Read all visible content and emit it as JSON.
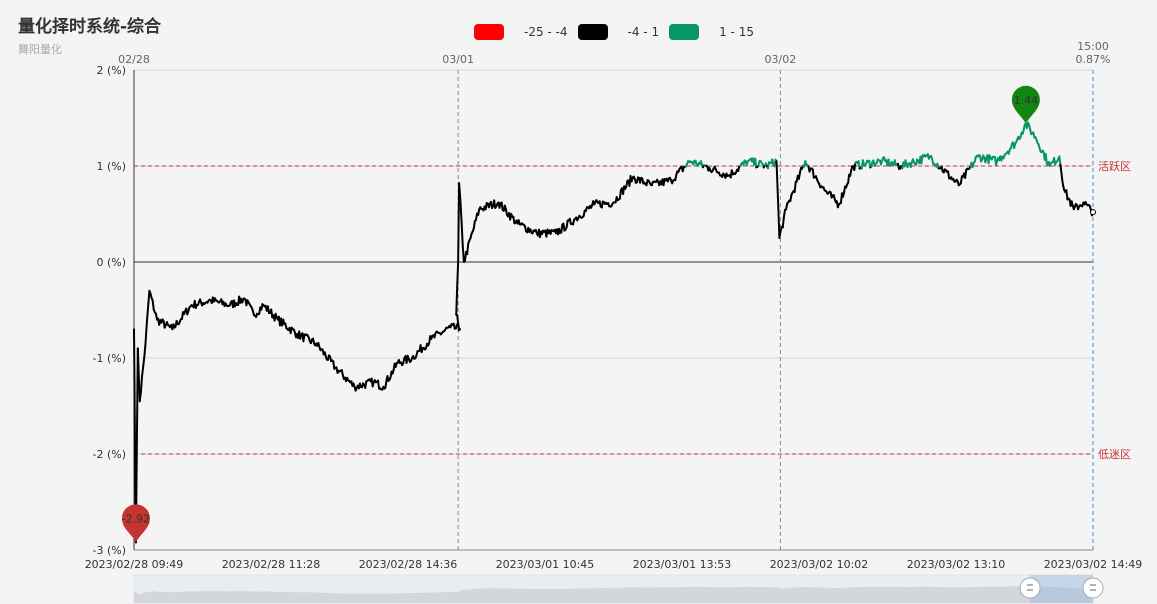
{
  "title": "量化择时系统-综合",
  "subtitle": "舞阳量化",
  "legend": [
    {
      "label": "-25 - -4",
      "color": "#ff0000"
    },
    {
      "label": "-4 - 1",
      "color": "#000000"
    },
    {
      "label": "1 - 15",
      "color": "#079664"
    }
  ],
  "chart_data": {
    "type": "line",
    "ylim": [
      -3,
      2
    ],
    "y_ticks": [
      "2 (%)",
      "1 (%)",
      "0 (%)",
      "-1 (%)",
      "-2 (%)",
      "-3 (%)"
    ],
    "x_ticks": [
      "2023/02/28 09:49",
      "2023/02/28 11:28",
      "2023/02/28 14:36",
      "2023/03/01 10:45",
      "2023/03/01 13:53",
      "2023/03/02 10:02",
      "2023/03/02 13:10",
      "2023/03/02 14:49"
    ],
    "top_axis_labels": [
      "02/28",
      "03/01",
      "03/02"
    ],
    "current_time_label": "15:00",
    "current_value_label": "0.87%",
    "mark_lines": [
      {
        "value": 1,
        "label": "活跃区"
      },
      {
        "value": -2,
        "label": "低迷区"
      }
    ],
    "max_point": {
      "value": 1.44,
      "label": "1.44"
    },
    "min_point": {
      "value": -2.92,
      "label": "-2.92"
    },
    "visual_map": [
      {
        "range": [
          -25,
          -4
        ],
        "color": "#ff0000"
      },
      {
        "range": [
          -4,
          1
        ],
        "color": "#000000"
      },
      {
        "range": [
          1,
          15
        ],
        "color": "#079664"
      }
    ],
    "series_keypoints": [
      [
        0,
        -0.7
      ],
      [
        0.002,
        -2.92
      ],
      [
        0.004,
        -0.9
      ],
      [
        0.006,
        -1.45
      ],
      [
        0.012,
        -0.85
      ],
      [
        0.016,
        -0.3
      ],
      [
        0.024,
        -0.6
      ],
      [
        0.04,
        -0.7
      ],
      [
        0.06,
        -0.45
      ],
      [
        0.08,
        -0.4
      ],
      [
        0.1,
        -0.45
      ],
      [
        0.115,
        -0.38
      ],
      [
        0.125,
        -0.55
      ],
      [
        0.135,
        -0.45
      ],
      [
        0.15,
        -0.6
      ],
      [
        0.17,
        -0.75
      ],
      [
        0.19,
        -0.85
      ],
      [
        0.21,
        -1.1
      ],
      [
        0.23,
        -1.3
      ],
      [
        0.25,
        -1.25
      ],
      [
        0.26,
        -1.3
      ],
      [
        0.275,
        -1.05
      ],
      [
        0.29,
        -1.0
      ],
      [
        0.31,
        -0.8
      ],
      [
        0.33,
        -0.68
      ],
      [
        0.34,
        -0.7
      ],
      [
        0.336,
        -0.55
      ],
      [
        0.338,
        0.0
      ],
      [
        0.339,
        0.82
      ],
      [
        0.344,
        0.0
      ],
      [
        0.36,
        0.55
      ],
      [
        0.38,
        0.62
      ],
      [
        0.4,
        0.4
      ],
      [
        0.42,
        0.3
      ],
      [
        0.44,
        0.3
      ],
      [
        0.46,
        0.45
      ],
      [
        0.48,
        0.6
      ],
      [
        0.5,
        0.62
      ],
      [
        0.52,
        0.88
      ],
      [
        0.54,
        0.8
      ],
      [
        0.56,
        0.85
      ],
      [
        0.58,
        1.05
      ],
      [
        0.6,
        0.98
      ],
      [
        0.62,
        0.9
      ],
      [
        0.64,
        1.05
      ],
      [
        0.66,
        1.0
      ],
      [
        0.67,
        1.05
      ],
      [
        0.673,
        0.25
      ],
      [
        0.68,
        0.55
      ],
      [
        0.7,
        1.05
      ],
      [
        0.72,
        0.75
      ],
      [
        0.735,
        0.6
      ],
      [
        0.75,
        1.0
      ],
      [
        0.78,
        1.05
      ],
      [
        0.8,
        1.0
      ],
      [
        0.83,
        1.1
      ],
      [
        0.86,
        0.8
      ],
      [
        0.88,
        1.1
      ],
      [
        0.9,
        1.05
      ],
      [
        0.92,
        1.25
      ],
      [
        0.93,
        1.44
      ],
      [
        0.94,
        1.3
      ],
      [
        0.955,
        1.0
      ],
      [
        0.965,
        1.1
      ],
      [
        0.97,
        0.75
      ],
      [
        0.98,
        0.55
      ],
      [
        0.99,
        0.62
      ],
      [
        1.0,
        0.52
      ]
    ]
  }
}
